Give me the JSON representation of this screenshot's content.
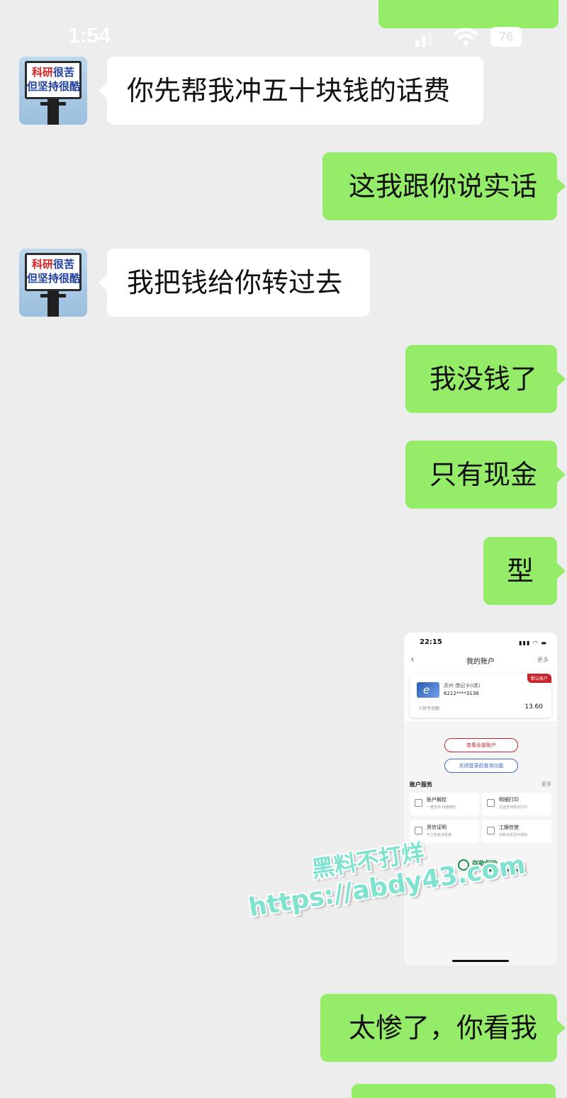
{
  "status_bar": {
    "time": "1:54",
    "battery": "76"
  },
  "messages": [
    {
      "side": "left",
      "text": "你先帮我冲五十块钱的话费"
    },
    {
      "side": "right",
      "text": "这我跟你说实话"
    },
    {
      "side": "left",
      "text": "我把钱给你转过去"
    },
    {
      "side": "right",
      "text": "我没钱了"
    },
    {
      "side": "right",
      "text": "只有现金"
    },
    {
      "side": "right",
      "text": "型"
    },
    {
      "side": "right",
      "text": "太惨了，你看我"
    }
  ],
  "avatar": {
    "line1_red": "科研",
    "line1_rest": "很苦",
    "line2": "但坚持很酷"
  },
  "screenshot": {
    "time": "22:15",
    "title": "我的账户",
    "more": "更多",
    "badge": "默认账户",
    "card_name": "苏州 借记卡(Ⅰ类)",
    "card_number": "6212****3138",
    "balance_label": "人民币余额",
    "balance": "13.60",
    "btn_view_all": "查看全部账户",
    "btn_close_query": "关闭登录前查询功能",
    "services_title": "账户服务",
    "services_more": "更多",
    "tiles": [
      {
        "title": "账户解控",
        "sub": "一键查询 快捷解控"
      },
      {
        "title": "明细打印",
        "sub": "足迹查询网点打印"
      },
      {
        "title": "资信证明",
        "sub": "开立和查询进度"
      },
      {
        "title": "工银信使",
        "sub": "动账信息及时通知"
      }
    ],
    "deposit_insurance": "存款保险"
  },
  "watermark": {
    "line1": "黑料不打烊",
    "line2": "https://abdy43.com"
  },
  "colors": {
    "bubble_green": "#95ec69",
    "background": "#ededed",
    "watermark": "#7fe3d0"
  }
}
